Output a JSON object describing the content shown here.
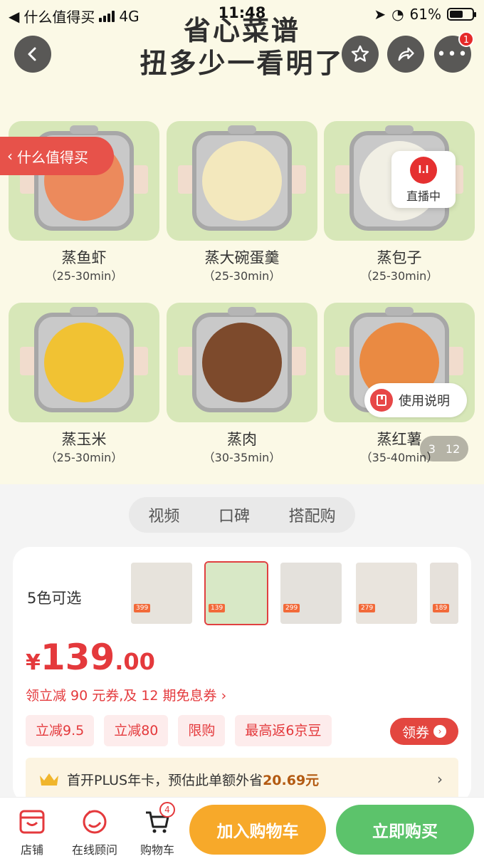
{
  "status_bar": {
    "back_app": "什么值得买",
    "network": "4G",
    "time": "11:48",
    "battery": "61%",
    "battery_level": 0.61
  },
  "hero": {
    "title_line1": "省心菜谱",
    "title_line2": "扭多少一看明了",
    "more_badge": "1",
    "float_tag": "什么值得买",
    "live_label": "直播中",
    "live_icon_text": "l.l",
    "manual_label": "使用说明",
    "pager_current": "3",
    "pager_total": "12",
    "recipes": [
      {
        "name": "蒸鱼虾",
        "time": "（25-30min）",
        "food_color": "#ec8a5c"
      },
      {
        "name": "蒸大碗蛋羹",
        "time": "（25-30min）",
        "food_color": "#f3e8bd"
      },
      {
        "name": "蒸包子",
        "time": "（25-30min）",
        "food_color": "#f1efe4"
      },
      {
        "name": "蒸玉米",
        "time": "（25-30min）",
        "food_color": "#f1c233"
      },
      {
        "name": "蒸肉",
        "time": "（30-35min）",
        "food_color": "#7d4a2c"
      },
      {
        "name": "蒸红薯",
        "time": "（35-40min）",
        "food_color": "#ea8a42"
      }
    ]
  },
  "tabs": [
    "视频",
    "口碑",
    "搭配购"
  ],
  "product": {
    "colors_label": "5色可选",
    "thumbnails": [
      {
        "tag": "399",
        "color": "#e7e3dc"
      },
      {
        "tag": "139",
        "color": "#d8e8c6"
      },
      {
        "tag": "299",
        "color": "#e4e1dc"
      },
      {
        "tag": "279",
        "color": "#e9e4dd"
      },
      {
        "tag": "189",
        "color": "#e6e1db"
      }
    ],
    "price_currency": "¥",
    "price_integer": "139",
    "price_decimal": ".00",
    "promo_line": "领立减 90 元券,及 12 期免息券 ›",
    "chips": [
      "立减9.5",
      "立减80",
      "限购",
      "最高返6京豆"
    ],
    "coupon_button": "领券",
    "plus_text": "首开PLUS年卡，预估此单额外省",
    "plus_amount": "20.69元"
  },
  "bottom_bar": {
    "store": "店铺",
    "consult": "在线顾问",
    "cart": "购物车",
    "cart_count": "4",
    "add_to_cart": "加入购物车",
    "buy_now": "立即购买"
  }
}
